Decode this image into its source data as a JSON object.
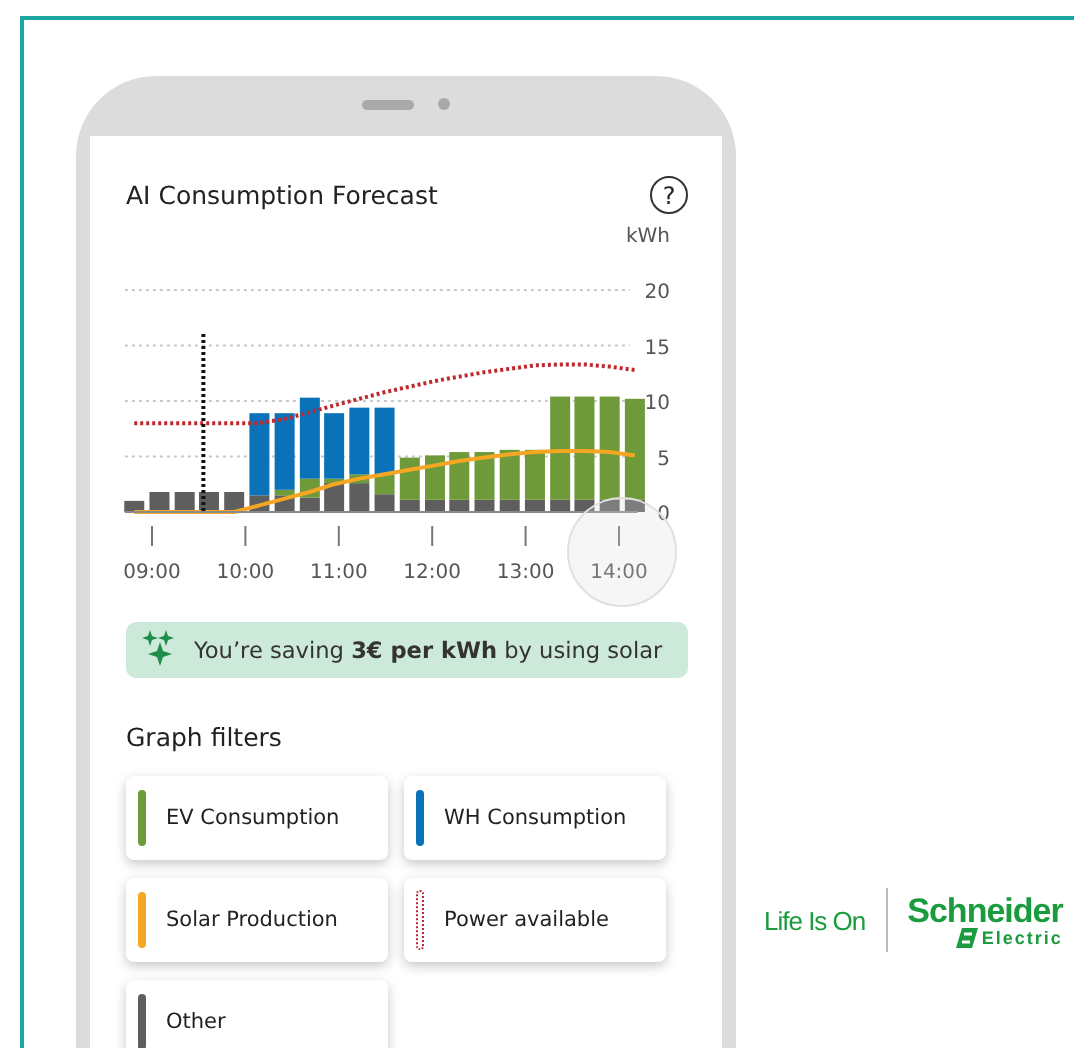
{
  "card": {
    "title": "AI Consumption Forecast",
    "help_icon": "?",
    "chart_data": {
      "type": "bar",
      "stacked": true,
      "grid": true,
      "ylabel": "kWh",
      "ylim": [
        0,
        20
      ],
      "yticks": [
        0,
        5,
        10,
        15,
        20
      ],
      "xlim": [
        8.71,
        14.2
      ],
      "xticks": [
        {
          "value": 9,
          "label": "09:00"
        },
        {
          "value": 10,
          "label": "10:00"
        },
        {
          "value": 11,
          "label": "11:00"
        },
        {
          "value": 12,
          "label": "12:00"
        },
        {
          "value": 13,
          "label": "13:00"
        },
        {
          "value": 14,
          "label": "14:00"
        }
      ],
      "x": [
        8.81,
        9.08,
        9.35,
        9.61,
        9.88,
        10.15,
        10.42,
        10.69,
        10.95,
        11.22,
        11.49,
        11.76,
        12.03,
        12.29,
        12.56,
        12.83,
        13.1,
        13.37,
        13.63,
        13.9,
        14.17
      ],
      "series": [
        {
          "name": "Other",
          "color": "#5e5e5e",
          "values": [
            1.0,
            1.8,
            1.8,
            1.8,
            1.8,
            1.5,
            1.5,
            1.3,
            2.6,
            2.6,
            1.6,
            1.1,
            1.1,
            1.1,
            1.1,
            1.1,
            1.1,
            1.1,
            1.1,
            1.1,
            1.1
          ]
        },
        {
          "name": "EV Consumption",
          "color": "#6e9a3a",
          "values": [
            0,
            0,
            0,
            0,
            0,
            0,
            0.5,
            1.7,
            0.4,
            0.8,
            1.8,
            3.8,
            4.0,
            4.3,
            4.3,
            4.5,
            4.5,
            9.3,
            9.3,
            9.3,
            9.1
          ]
        },
        {
          "name": "WH Consumption",
          "color": "#0a72b8",
          "values": [
            0,
            0,
            0,
            0,
            0,
            7.4,
            6.9,
            7.3,
            5.9,
            6.0,
            6.0,
            0,
            0,
            0,
            0,
            0,
            0,
            0,
            0,
            0,
            0
          ]
        },
        {
          "name": "Solar Production",
          "type": "line",
          "color": "#f5a623",
          "values": [
            0,
            0,
            0,
            0,
            0,
            0.6,
            1.2,
            1.8,
            2.5,
            3.0,
            3.4,
            3.8,
            4.2,
            4.6,
            4.9,
            5.2,
            5.4,
            5.5,
            5.5,
            5.4,
            5.1
          ]
        },
        {
          "name": "Power available",
          "type": "line",
          "line_style": "dotted",
          "color": "#c0282d",
          "values": [
            8.0,
            8.0,
            8.0,
            8.0,
            8.0,
            8.0,
            8.4,
            9.0,
            9.6,
            10.2,
            10.8,
            11.3,
            11.8,
            12.2,
            12.6,
            12.9,
            13.2,
            13.3,
            13.3,
            13.1,
            12.8
          ]
        }
      ],
      "ref_lines": [
        {
          "axis": "x",
          "value": 9.55,
          "line_style": "dotted",
          "color": "#111111"
        }
      ]
    }
  },
  "banner": {
    "text": "You’re saving **3€ per kWh** by using solar"
  },
  "filters": {
    "title": "Graph filters"
  },
  "brand": {
    "tagline": "Life Is On",
    "name": "Schneider",
    "subname": "Electric"
  }
}
